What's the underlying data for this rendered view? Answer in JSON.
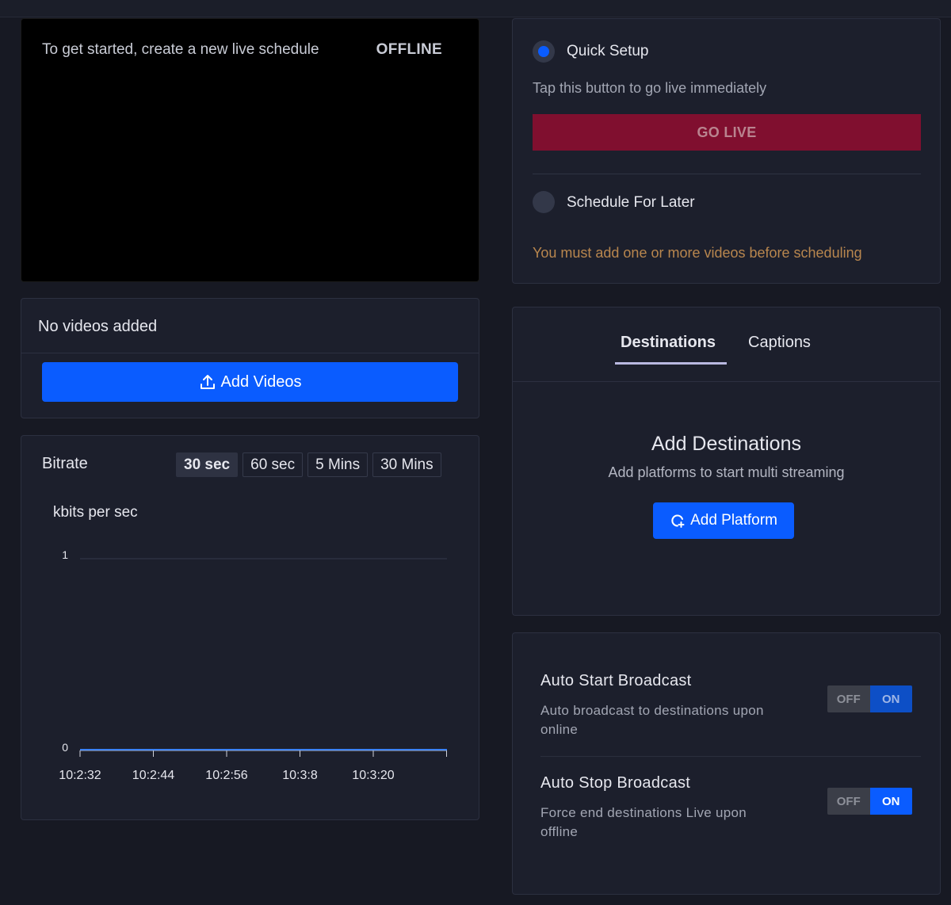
{
  "preview": {
    "message": "To get started, create a new live schedule",
    "status": "OFFLINE"
  },
  "videos": {
    "empty_text": "No videos added",
    "add_button": "Add Videos",
    "add_icon": "upload-icon"
  },
  "bitrate": {
    "title": "Bitrate",
    "ranges": [
      "30 sec",
      "60 sec",
      "5 Mins",
      "30 Mins"
    ],
    "selected_range": "30 sec"
  },
  "chart_data": {
    "type": "line",
    "title": "",
    "xlabel": "",
    "ylabel": "kbits per sec",
    "x_ticks": [
      "10:2:32",
      "10:2:44",
      "10:2:56",
      "10:3:8",
      "10:3:20"
    ],
    "y_ticks": [
      "1",
      "0"
    ],
    "ylim": [
      0,
      1
    ],
    "series": [
      {
        "values": [
          0,
          0,
          0,
          0,
          0,
          0
        ],
        "color": "#3b82f6"
      }
    ],
    "grid": true
  },
  "setup": {
    "quick_label": "Quick Setup",
    "quick_hint": "Tap this button to go live immediately",
    "go_live": "GO LIVE",
    "schedule_label": "Schedule For Later",
    "schedule_warning": "You must add one or more videos before scheduling",
    "selected": "quick"
  },
  "destinations": {
    "tabs": [
      "Destinations",
      "Captions"
    ],
    "active_tab": "Destinations",
    "heading": "Add Destinations",
    "subheading": "Add platforms to start multi streaming",
    "add_button": "Add Platform",
    "add_icon": "add-platform-icon"
  },
  "auto": {
    "start_title": "Auto Start Broadcast",
    "start_desc": "Auto broadcast to destinations upon online",
    "stop_title": "Auto Stop Broadcast",
    "stop_desc": "Force end destinations Live upon offline",
    "toggle_off": "OFF",
    "toggle_on": "ON",
    "start_value": "ON",
    "stop_value": "ON"
  },
  "colors": {
    "accent": "#0a5cff",
    "go_live": "#800f2f",
    "warning": "#b8864e",
    "background": "#171923"
  }
}
